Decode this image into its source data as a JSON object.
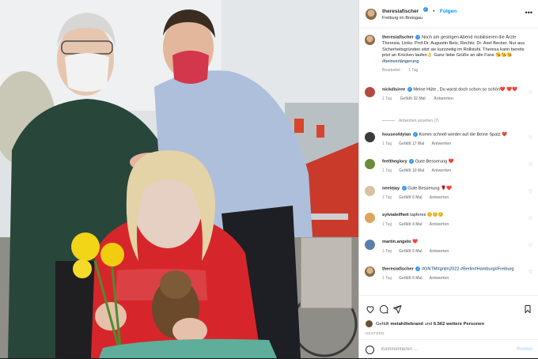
{
  "post": {
    "username": "theresiafischer",
    "follow_label": "Folgen",
    "separator": "•",
    "location": "Freiburg im Breisgau",
    "more_icon": "more-horizontal-icon"
  },
  "caption": {
    "username": "theresiafischer",
    "text": "Noch am gestrigen Abend mobilisieren die Ärzte Theresia. Links: Prof.Dr. Augustin Betz, Rechts: Dr. Axel Becker. Nur aus Sicherheitsgründen sitzt sie kurzzeitig im Rollstuhl. Theresa kann bereits jetzt an Krücken laufen👌 Ganz liebe Grüße an alle Fans 😘😘😘",
    "hashtag": "#beinverlängerung",
    "edited": "Bearbeitet",
    "time": "1 Tag"
  },
  "comments": [
    {
      "username": "nickdisiree",
      "text": "Meine Hüte , Du warst doch schon so schön❤️ ❤️❤️",
      "time": "1 Tag",
      "likes": "Gefällt 32 Mal",
      "reply": "Antworten",
      "replies": "Antworten ansehen (7)"
    },
    {
      "username": "houseofdylan",
      "text": "Komm schnell wieder auf die Beine Spatz ❤️",
      "time": "1 Tag",
      "likes": "Gefällt 17 Mal",
      "reply": "Antworten"
    },
    {
      "username": "feelthеglory",
      "text": "Gute Besserung ❤️",
      "time": "1 Tag",
      "likes": "Gefällt 10 Mal",
      "reply": "Antworten"
    },
    {
      "username": "neelejay",
      "text": "Gute Besserung 🌹❤️",
      "time": "1 Tag",
      "likes": "Gefällt 6 Mal",
      "reply": "Antworten"
    },
    {
      "username": "sylvialeifheit",
      "text": "tapferes 😊😊😊",
      "time": "1 Tag",
      "likes": "Gefällt 4 Mal",
      "reply": "Antworten"
    },
    {
      "username": "martin.angelo",
      "text": "❤️",
      "time": "1 Tag",
      "likes": "Gefällt 5 Mal",
      "reply": "Antworten"
    },
    {
      "username": "theresiafischer",
      "text": "#GNTM#gntm2022 #Berlin#Hamburg#Freiburg",
      "time": "1 Tag",
      "likes": "Gefällt 6 Mal",
      "reply": "Antworten"
    }
  ],
  "likes": {
    "prefix": "Gefällt",
    "user": "metahiltebrand",
    "mid": "und",
    "count": "6.562 weitere Personen"
  },
  "date_label": "GESTERN",
  "comment_box": {
    "placeholder": "Kommentieren ...",
    "post_label": "Posten"
  },
  "icons": [
    "heart-icon",
    "comment-icon",
    "share-icon",
    "bookmark-icon",
    "emoji-icon"
  ],
  "colors": {
    "link": "#0095f6",
    "hashtag": "#00376b",
    "muted": "#8e8e8e",
    "verified": "#3897f0"
  }
}
